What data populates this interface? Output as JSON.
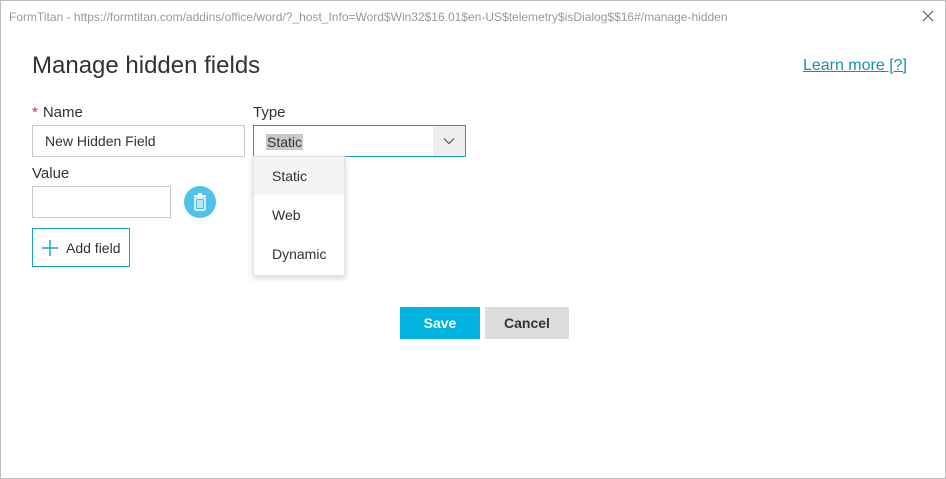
{
  "window": {
    "title": "FormTitan - https://formtitan.com/addins/office/word/?_host_Info=Word$Win32$16.01$en-US$telemetry$isDialog$$16#/manage-hidden"
  },
  "dialog": {
    "heading": "Manage hidden fields",
    "learn_more": "Learn more [?]"
  },
  "form": {
    "name_required_marker": "*",
    "name_label": "Name",
    "name_value": "New Hidden Field",
    "type_label": "Type",
    "type_selected": "Static",
    "type_options": [
      "Static",
      "Web",
      "Dynamic"
    ],
    "value_label": "Value",
    "value_value": "",
    "add_field_label": "Add field"
  },
  "actions": {
    "save_label": "Save",
    "cancel_label": "Cancel"
  },
  "icons": {
    "close": "close-icon",
    "chevron": "chevron-down-icon",
    "trash": "trash-icon",
    "plus": "plus-icon"
  },
  "colors": {
    "accent": "#00b4df",
    "border_focus": "#1a9fc8",
    "link": "#1a8fb3",
    "required": "#d32f2f",
    "trash_button": "#4fc3e8",
    "cancel_bg": "#dcdcdc"
  }
}
